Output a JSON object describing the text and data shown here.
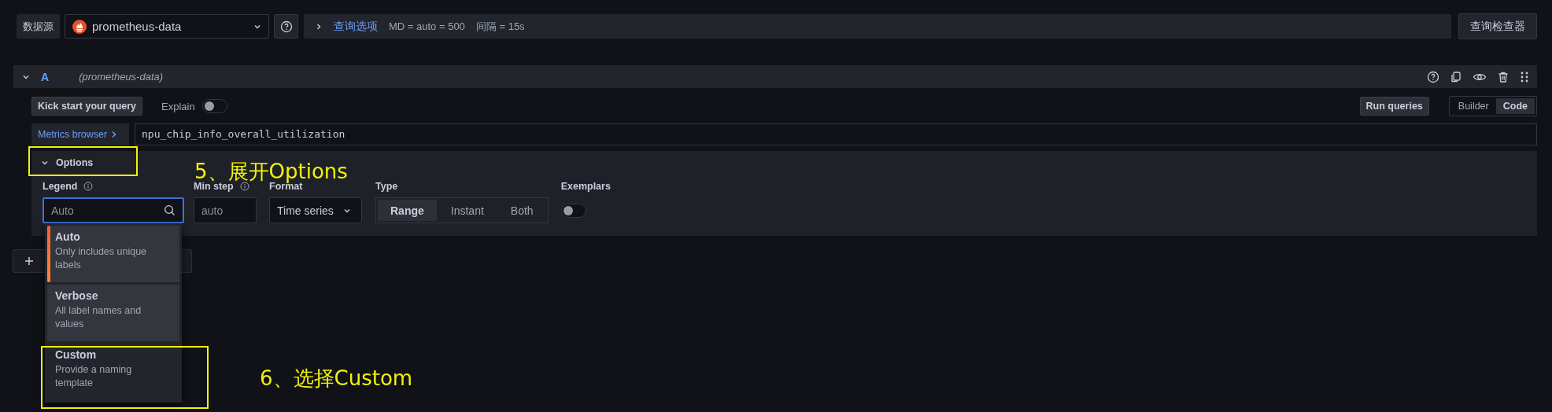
{
  "toolbar": {
    "datasource_label": "数据源",
    "datasource": "prometheus-data",
    "query_options_label": "查询选项",
    "query_options_summary": [
      "MD = auto = 500",
      "间隔 = 15s"
    ],
    "inspector_button": "查询检查器"
  },
  "query": {
    "ref": "A",
    "datasource": "(prometheus-data)",
    "expanded": true,
    "kick_start": "Kick start your query",
    "explain": {
      "label": "Explain",
      "on": false
    },
    "run_button": "Run queries",
    "modes": [
      {
        "label": "Builder",
        "selected": false
      },
      {
        "label": "Code",
        "selected": true
      }
    ],
    "metrics_browser": "Metrics browser",
    "expression": "npu_chip_info_overall_utilization"
  },
  "options": {
    "label": "Options",
    "expanded": true,
    "fields": [
      {
        "kind": "search-select",
        "label": "Legend",
        "info": true,
        "placeholder": "Auto",
        "focused": true
      },
      {
        "kind": "input",
        "label": "Min step",
        "info": true,
        "placeholder": "auto"
      },
      {
        "kind": "select",
        "label": "Format",
        "value": "Time series"
      },
      {
        "kind": "radio",
        "label": "Type",
        "options": [
          {
            "label": "Range",
            "selected": true
          },
          {
            "label": "Instant",
            "selected": false
          },
          {
            "label": "Both",
            "selected": false
          }
        ]
      },
      {
        "kind": "toggle",
        "label": "Exemplars",
        "on": false
      }
    ]
  },
  "legend_menu": [
    {
      "title": "Auto",
      "description": "Only includes unique labels",
      "selected": true,
      "hovered": false
    },
    {
      "title": "Verbose",
      "description": "All label names and values",
      "selected": false,
      "hovered": true
    },
    {
      "title": "Custom",
      "description": "Provide a naming template",
      "selected": false,
      "hovered": false
    }
  ],
  "annotations": [
    {
      "text": "5、展开Options"
    },
    {
      "text": "6、选择Custom"
    }
  ]
}
